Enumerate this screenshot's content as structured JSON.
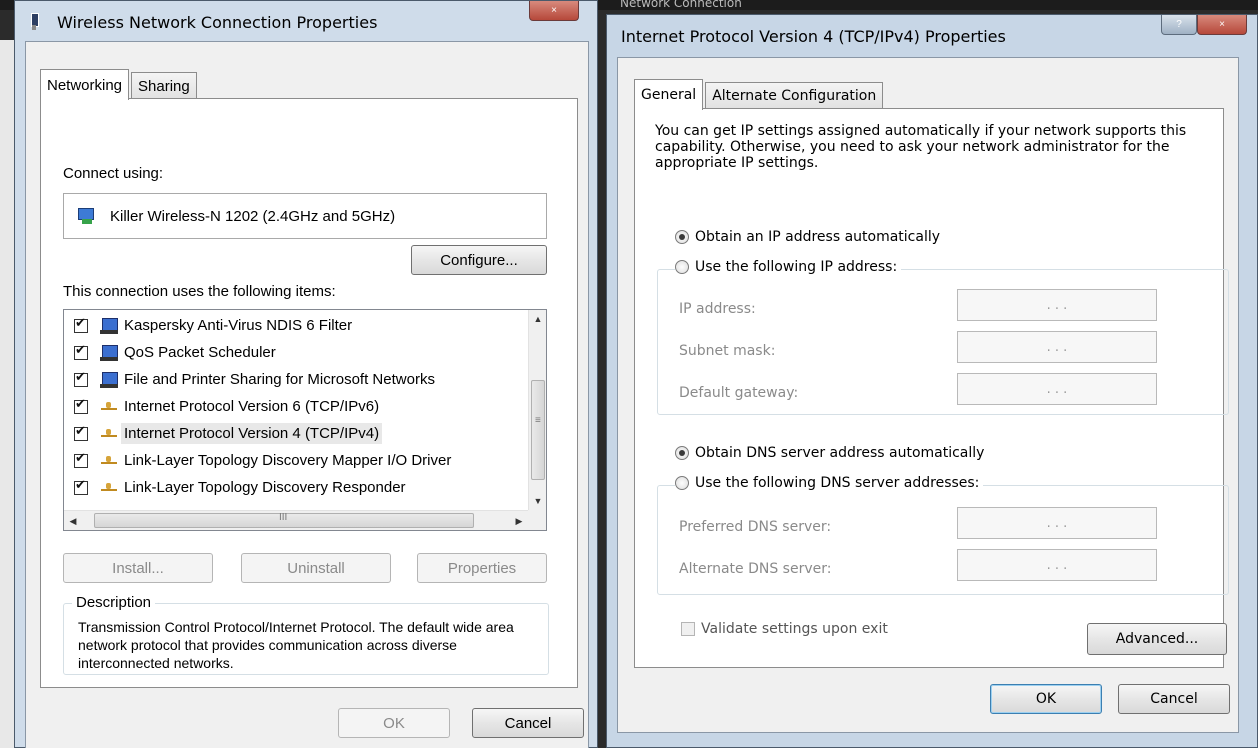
{
  "background": {
    "partial_text": "Network Connection"
  },
  "left_window": {
    "title": "Wireless Network Connection Properties",
    "caption_close": "×",
    "tabs": [
      {
        "label": "Networking",
        "active": true
      },
      {
        "label": "Sharing",
        "active": false
      }
    ],
    "connect_using_label": "Connect using:",
    "adapter_name": "Killer Wireless-N 1202 (2.4GHz and 5GHz)",
    "configure_label": "Configure...",
    "items_label": "This connection uses the following items:",
    "items": [
      {
        "label": "Kaspersky Anti-Virus NDIS 6 Filter",
        "icon": "computer-icon",
        "checked": true
      },
      {
        "label": "QoS Packet Scheduler",
        "icon": "computer-icon",
        "checked": true
      },
      {
        "label": "File and Printer Sharing for Microsoft Networks",
        "icon": "computer-icon",
        "checked": true
      },
      {
        "label": "Internet Protocol Version 6 (TCP/IPv6)",
        "icon": "protocol-icon",
        "checked": true
      },
      {
        "label": "Internet Protocol Version 4 (TCP/IPv4)",
        "icon": "protocol-icon",
        "checked": true,
        "selected": true
      },
      {
        "label": "Link-Layer Topology Discovery Mapper I/O Driver",
        "icon": "protocol-icon",
        "checked": true
      },
      {
        "label": "Link-Layer Topology Discovery Responder",
        "icon": "protocol-icon",
        "checked": true
      }
    ],
    "install_label": "Install...",
    "uninstall_label": "Uninstall",
    "properties_label": "Properties",
    "description_legend": "Description",
    "description_text": "Transmission Control Protocol/Internet Protocol. The default wide area network protocol that provides communication across diverse interconnected networks.",
    "ok_label": "OK",
    "cancel_label": "Cancel"
  },
  "right_window": {
    "title": "Internet Protocol Version 4 (TCP/IPv4) Properties",
    "caption_help": "?",
    "caption_close": "×",
    "tabs": [
      {
        "label": "General",
        "active": true
      },
      {
        "label": "Alternate Configuration",
        "active": false
      }
    ],
    "intro": "You can get IP settings assigned automatically if your network supports this capability. Otherwise, you need to ask your network administrator for the appropriate IP settings.",
    "obtain_ip_auto": "Obtain an IP address automatically",
    "use_following_ip": "Use the following IP address:",
    "ip_address_label": "IP address:",
    "subnet_mask_label": "Subnet mask:",
    "default_gateway_label": "Default gateway:",
    "ip_placeholder": ".        .        .",
    "obtain_dns_auto": "Obtain DNS server address automatically",
    "use_following_dns": "Use the following DNS server addresses:",
    "preferred_dns_label": "Preferred DNS server:",
    "alternate_dns_label": "Alternate DNS server:",
    "validate_label": "Validate settings upon exit",
    "advanced_label": "Advanced...",
    "ok_label": "OK",
    "cancel_label": "Cancel"
  }
}
